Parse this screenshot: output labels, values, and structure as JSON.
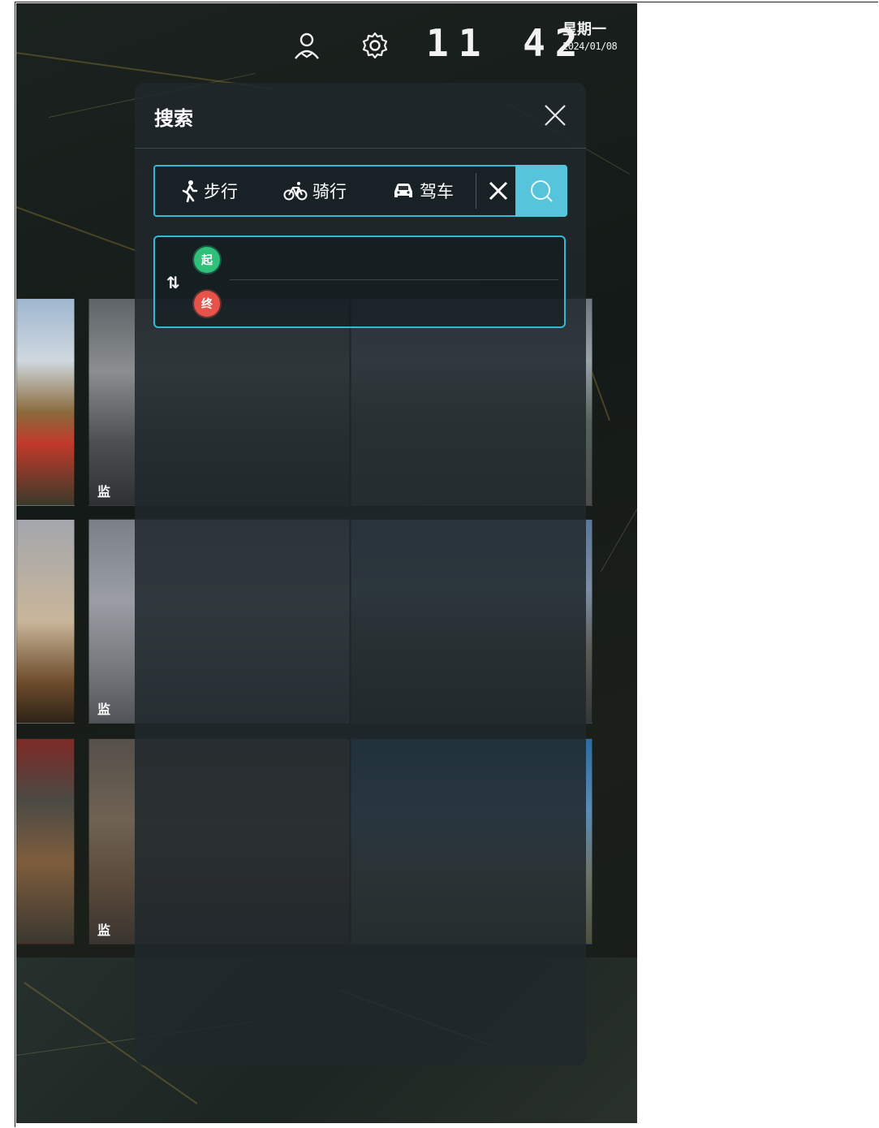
{
  "status_bar": {
    "icons": [
      "user-icon",
      "gear-icon"
    ],
    "time": "11 42",
    "weekday": "星期一",
    "date": "2024/01/08"
  },
  "background_tiles": {
    "tag": "监"
  },
  "search_panel": {
    "title": "搜索",
    "close_icon": "close-icon",
    "modes": [
      {
        "label": "步行",
        "icon": "walk-icon",
        "active": true
      },
      {
        "label": "骑行",
        "icon": "bicycle-icon",
        "active": false
      },
      {
        "label": "驾车",
        "icon": "car-icon",
        "active": false
      }
    ],
    "clear_icon": "close-icon",
    "search_icon": "search-icon",
    "accent_color": "#34b9d4",
    "route": {
      "swap_icon": "⇅",
      "start_badge": "起",
      "end_badge": "终",
      "start_value": "",
      "end_value": "",
      "start_color": "#2fc07a",
      "end_color": "#e5534b"
    }
  }
}
